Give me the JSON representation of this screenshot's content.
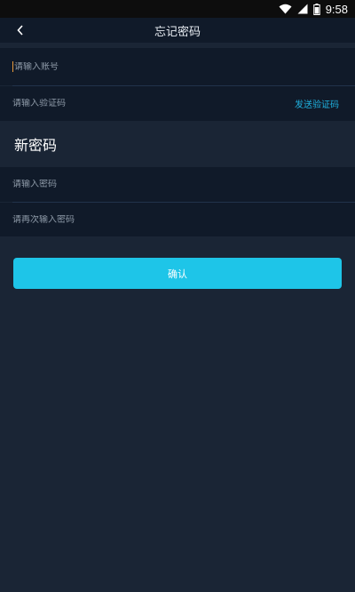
{
  "status_bar": {
    "time": "9:58",
    "icons": [
      "wifi-icon",
      "signal-icon",
      "battery-icon"
    ]
  },
  "header": {
    "title": "忘记密码",
    "back_icon": "chevron-left-icon"
  },
  "form": {
    "account": {
      "placeholder": "请输入账号",
      "value": ""
    },
    "code": {
      "placeholder": "请输入验证码",
      "value": "",
      "send_label": "发送验证码"
    },
    "section_title": "新密码",
    "password": {
      "placeholder": "请输入密码",
      "value": ""
    },
    "password_repeat": {
      "placeholder": "请再次输入密码",
      "value": ""
    }
  },
  "confirm_button": {
    "label": "确认"
  },
  "colors": {
    "background": "#1a2535",
    "panel": "#101a29",
    "accent": "#1ec5e8",
    "link": "#1fb2e0",
    "caret": "#e89a3c"
  }
}
